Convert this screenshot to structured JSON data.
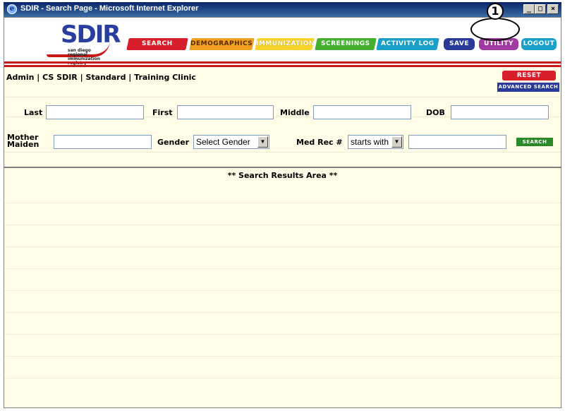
{
  "window": {
    "title": "SDIR - Search Page - Microsoft Internet Explorer",
    "minimize": "_",
    "maximize": "□",
    "close": "×"
  },
  "logo": {
    "text": "SDIR",
    "subtitle_lines": [
      "san diego",
      "regional",
      "immunization registry"
    ]
  },
  "nav": {
    "search": "SEARCH",
    "demographics": "DEMOGRAPHICS",
    "immunization": "IMMUNIZATION",
    "screenings": "SCREENINGS",
    "activity_log": "ACTIVITY LOG",
    "save": "SAVE",
    "utility": "UTILITY",
    "logout": "LOGOUT"
  },
  "callout": {
    "number": "1"
  },
  "user_info": "Admin | CS SDIR | Standard | Training Clinic",
  "buttons": {
    "reset": "RESET",
    "advanced_search": "ADVANCED SEARCH",
    "search": "SEARCH"
  },
  "form": {
    "last_label": "Last",
    "first_label": "First",
    "middle_label": "Middle",
    "dob_label": "DOB",
    "mother_maiden_label_1": "Mother",
    "mother_maiden_label_2": "Maiden",
    "gender_label": "Gender",
    "gender_value": "Select Gender",
    "medrec_label": "Med Rec #",
    "medrec_mode": "starts with",
    "last_value": "",
    "first_value": "",
    "middle_value": "",
    "dob_value": "",
    "mother_maiden_value": "",
    "medrec_value": ""
  },
  "results": {
    "title": "** Search Results Area **"
  },
  "colors": {
    "search_tab": "#d81e2a",
    "demographics_tab": "#f0a020",
    "immunization_tab": "#f6d42c",
    "screenings_tab": "#44b030",
    "activity_tab": "#1aa0c8",
    "save_tab": "#2a3a9a",
    "utility_tab": "#a03aa0",
    "background": "#fffde8"
  }
}
